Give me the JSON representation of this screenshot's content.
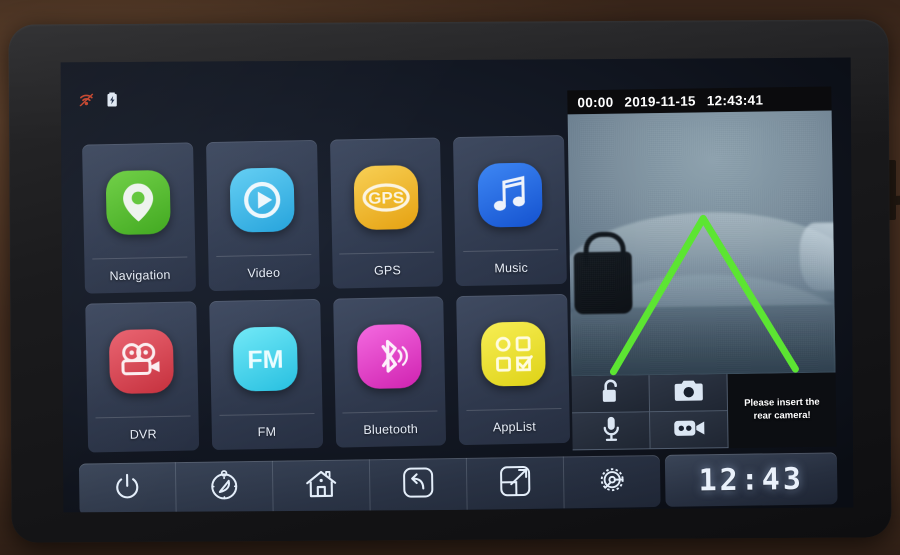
{
  "device": {
    "type": "car-head-unit",
    "bezel_color": "#1b1b1d",
    "background_color": "#6b4a32"
  },
  "statusbar": {
    "icons": [
      {
        "name": "wifi-disconnected-icon",
        "color": "#c4442c"
      },
      {
        "name": "battery-charging-icon",
        "color": "#dfe7f2"
      }
    ]
  },
  "apps": [
    {
      "label": "Navigation",
      "icon": "map-pin-icon",
      "color": "#5fc63a",
      "color2": "#46ad22"
    },
    {
      "label": "Video",
      "icon": "play-circle-icon",
      "color": "#4fc3ef",
      "color2": "#29a9df"
    },
    {
      "label": "GPS",
      "icon": "gps-text-icon",
      "color": "#f5c640",
      "color2": "#e8a818"
    },
    {
      "label": "Music",
      "icon": "music-note-icon",
      "color": "#2d79ef",
      "color2": "#1a5ed8"
    },
    {
      "label": "DVR",
      "icon": "movie-camera-icon",
      "color": "#e05360",
      "color2": "#c9343f"
    },
    {
      "label": "FM",
      "icon": "fm-text-icon",
      "color": "#58e0f2",
      "color2": "#2bc6e4"
    },
    {
      "label": "Bluetooth",
      "icon": "bluetooth-icon",
      "color": "#ef57d6",
      "color2": "#d62ab8"
    },
    {
      "label": "AppList",
      "icon": "app-grid-icon",
      "color": "#f2e63f",
      "color2": "#e0cf16"
    }
  ],
  "camera": {
    "timestamp": {
      "duration": "00:00",
      "date": "2019-11-15",
      "time": "12:43:41"
    },
    "guide_color": "#5ce532",
    "message": "Please insert the rear camera!",
    "controls": [
      {
        "name": "unlock-icon",
        "label": "unlock"
      },
      {
        "name": "photo-camera-icon",
        "label": "snapshot"
      },
      {
        "name": "microphone-icon",
        "label": "microphone"
      },
      {
        "name": "video-camera-icon",
        "label": "record"
      }
    ]
  },
  "navbar": {
    "buttons": [
      {
        "name": "power-icon",
        "label": "Power"
      },
      {
        "name": "compass-icon",
        "label": "Navigation"
      },
      {
        "name": "home-icon",
        "label": "Home"
      },
      {
        "name": "back-icon",
        "label": "Back"
      },
      {
        "name": "resize-icon",
        "label": "Split"
      },
      {
        "name": "settings-gear-icon",
        "label": "Settings"
      }
    ],
    "clock": "12:43"
  }
}
